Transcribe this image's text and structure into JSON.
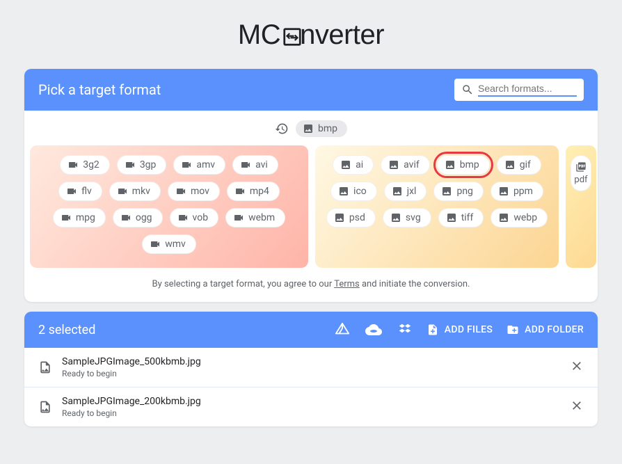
{
  "brand": {
    "name_part1": "MC",
    "name_part2": "nverter"
  },
  "picker": {
    "title": "Pick a target format",
    "search_placeholder": "Search formats...",
    "recent_label": "bmp",
    "terms_prefix": "By selecting a target format, you agree to our ",
    "terms_link": "Terms",
    "terms_suffix": " and initiate the conversion."
  },
  "formats": {
    "video": [
      "3g2",
      "3gp",
      "amv",
      "avi",
      "flv",
      "mkv",
      "mov",
      "mp4",
      "mpg",
      "ogg",
      "vob",
      "webm",
      "wmv"
    ],
    "image": [
      "ai",
      "avif",
      "bmp",
      "gif",
      "ico",
      "jxl",
      "png",
      "ppm",
      "psd",
      "svg",
      "tiff",
      "webp"
    ],
    "doc": [
      "pdf"
    ],
    "selected": "bmp"
  },
  "queue": {
    "title": "2 selected",
    "add_files_label": "ADD FILES",
    "add_folder_label": "ADD FOLDER",
    "files": [
      {
        "name": "SampleJPGImage_500kbmb.jpg",
        "status": "Ready to begin"
      },
      {
        "name": "SampleJPGImage_200kbmb.jpg",
        "status": "Ready to begin"
      }
    ]
  }
}
